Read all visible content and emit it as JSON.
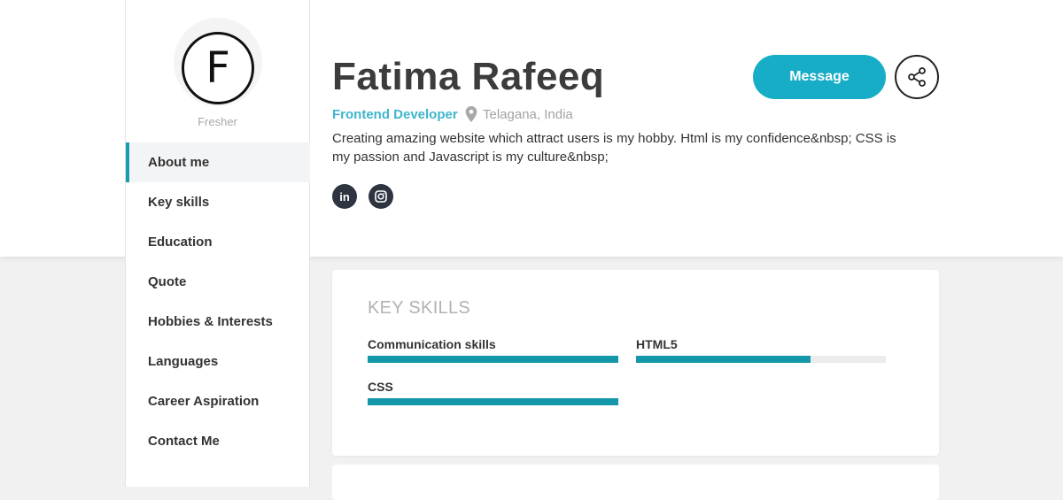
{
  "profile": {
    "avatar_letter": "F",
    "level": "Fresher",
    "name": "Fatima Rafeeq",
    "role": "Frontend Developer",
    "location": "Telagana, India",
    "bio": "Creating amazing website which attract users is my hobby. Html is my confidence&nbsp; CSS is my passion and Javascript is my culture&nbsp;",
    "message_label": "Message",
    "linkedin_label": "in"
  },
  "nav": {
    "items": [
      {
        "label": "About me",
        "active": true
      },
      {
        "label": "Key skills"
      },
      {
        "label": "Education"
      },
      {
        "label": "Quote"
      },
      {
        "label": "Hobbies & Interests"
      },
      {
        "label": "Languages"
      },
      {
        "label": "Career Aspiration"
      },
      {
        "label": "Contact Me"
      }
    ]
  },
  "skills_card": {
    "title": "KEY SKILLS",
    "skills": [
      {
        "name": "Communication skills",
        "level": 1.0
      },
      {
        "name": "HTML5",
        "level": 0.7
      },
      {
        "name": "CSS",
        "level": 1.0
      }
    ]
  },
  "colors": {
    "accent": "#17adc7",
    "bar_fill": "#1497a8",
    "role_text": "#3eb5cc"
  },
  "icons": {
    "location": "map-pin-icon",
    "share": "share-icon",
    "linkedin": "linkedin-icon",
    "instagram": "instagram-icon"
  }
}
